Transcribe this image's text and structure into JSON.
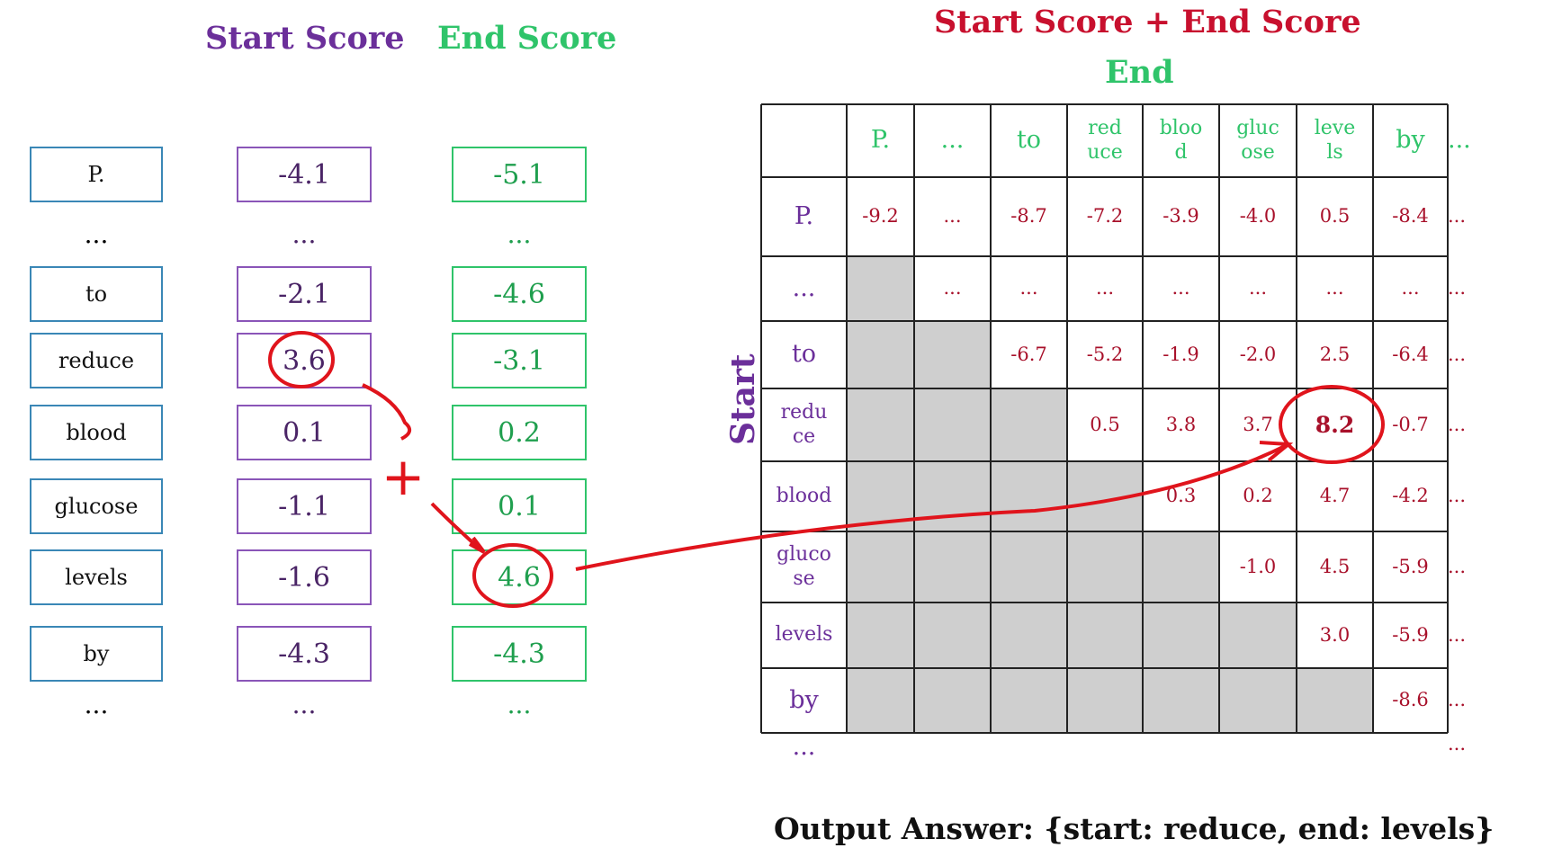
{
  "left": {
    "start_header": "Start Score",
    "end_header": "End Score",
    "tokens": [
      "P.",
      "...",
      "to",
      "reduce",
      "blood",
      "glucose",
      "levels",
      "by",
      "..."
    ],
    "start_scores": [
      "-4.1",
      "...",
      "-2.1",
      "3.6",
      "0.1",
      "-1.1",
      "-1.6",
      "-4.3",
      "..."
    ],
    "end_scores": [
      "-5.1",
      "...",
      "-4.6",
      "-3.1",
      "0.2",
      "0.1",
      "4.6",
      "-4.3",
      "..."
    ]
  },
  "right": {
    "title": "Start Score + End Score",
    "end_label": "End",
    "start_label": "Start",
    "col_headers": [
      "P.",
      "...",
      "to",
      "red\nuce",
      "bloo\nd",
      "gluc\nose",
      "leve\nls",
      "by",
      "..."
    ],
    "row_headers": [
      "P.",
      "...",
      "to",
      "redu\nce",
      "blood",
      "gluco\nse",
      "levels",
      "by",
      "..."
    ],
    "cells": [
      [
        "-9.2",
        "...",
        "-8.7",
        "-7.2",
        "-3.9",
        "-4.0",
        "0.5",
        "-8.4",
        "..."
      ],
      [
        null,
        "...",
        "...",
        "...",
        "...",
        "...",
        "...",
        "...",
        "..."
      ],
      [
        null,
        null,
        "-6.7",
        "-5.2",
        "-1.9",
        "-2.0",
        "2.5",
        "-6.4",
        "..."
      ],
      [
        null,
        null,
        null,
        "0.5",
        "3.8",
        "3.7",
        "8.2",
        "-0.7",
        "..."
      ],
      [
        null,
        null,
        null,
        null,
        "0.3",
        "0.2",
        "4.7",
        "-4.2",
        "..."
      ],
      [
        null,
        null,
        null,
        null,
        null,
        "-1.0",
        "4.5",
        "-5.9",
        "..."
      ],
      [
        null,
        null,
        null,
        null,
        null,
        null,
        "3.0",
        "-5.9",
        "..."
      ],
      [
        null,
        null,
        null,
        null,
        null,
        null,
        null,
        "-8.6",
        "..."
      ],
      [
        null,
        null,
        null,
        null,
        null,
        null,
        null,
        null,
        "..."
      ]
    ],
    "highlight": {
      "row": 3,
      "col": 6,
      "value": "8.2"
    },
    "output_answer": "Output Answer:  {start: reduce, end: levels}"
  },
  "annotation": {
    "plus_symbol": "+"
  },
  "colors": {
    "purple": "#6b2f9a",
    "green": "#2fc46a",
    "red": "#c8102e",
    "token_border": "#3a87b6",
    "gray_cell": "#cfcfcf"
  }
}
